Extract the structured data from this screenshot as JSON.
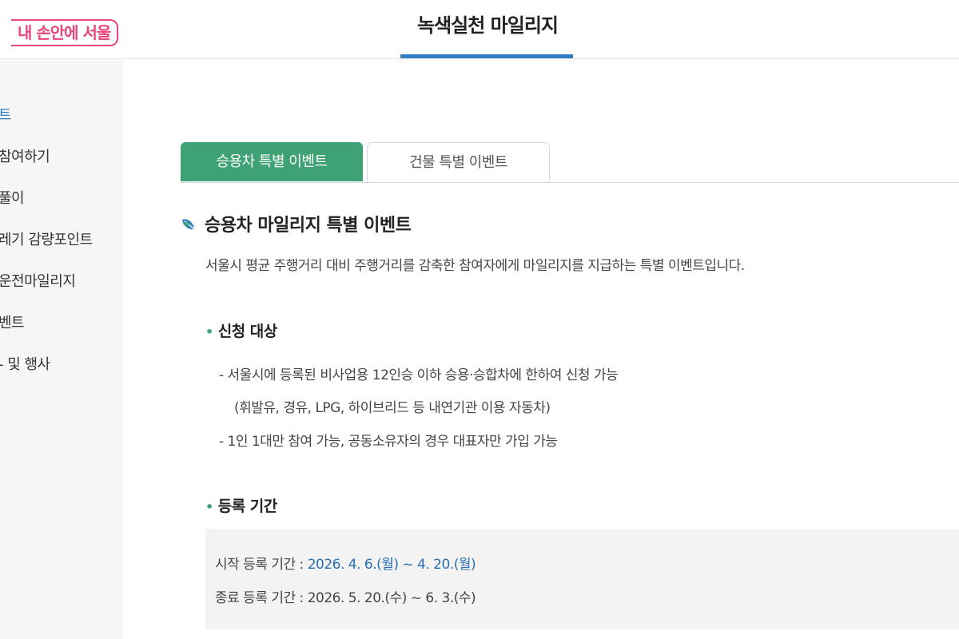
{
  "header": {
    "logo_text": "내 손안에 서울",
    "title": "녹색실천 마일리지"
  },
  "sidebar": {
    "items": [
      {
        "label": "트",
        "active": true
      },
      {
        "label": "참여하기",
        "active": false
      },
      {
        "label": "풀이",
        "active": false
      },
      {
        "label": "레기 감량포인트",
        "active": false
      },
      {
        "label": "운전마일리지",
        "active": false
      },
      {
        "label": "벤트",
        "active": false
      },
      {
        "label": "- 및 행사",
        "active": false
      }
    ]
  },
  "tabs": [
    {
      "label": "승용차 특별 이벤트",
      "active": true
    },
    {
      "label": "건물 특별 이벤트",
      "active": false
    }
  ],
  "content": {
    "heading": "승용차 마일리지 특별 이벤트",
    "description": "서울시 평균 주행거리 대비 주행거리를 감축한 참여자에게 마일리지를 지급하는 특별 이벤트입니다.",
    "target": {
      "title": "신청 대상",
      "lines": [
        "- 서울시에 등록된 비사업용 12인승 이하 승용·승합차에 한하여 신청 가능",
        "(휘발유, 경유, LPG, 하이브리드 등 내연기관 이용 자동차)",
        "- 1인 1대만 참여 가능, 공동소유자의 경우 대표자만 가입 가능"
      ]
    },
    "period": {
      "title": "등록 기간",
      "start_label": "시작 등록 기간 : ",
      "start_value": "2026. 4. 6.(월) ~ 4. 20.(월)",
      "end_label": "종료 등록 기간 : ",
      "end_value": "2026. 5. 20.(수) ~ 6. 3.(수)"
    }
  },
  "colors": {
    "accent_blue": "#2f7fc1",
    "tab_green": "#3fa274",
    "logo_pink": "#e8467c",
    "highlight_blue": "#2a6fb3"
  },
  "icons": {
    "heading_icon": "leaf-icon",
    "bullet": "dot"
  }
}
